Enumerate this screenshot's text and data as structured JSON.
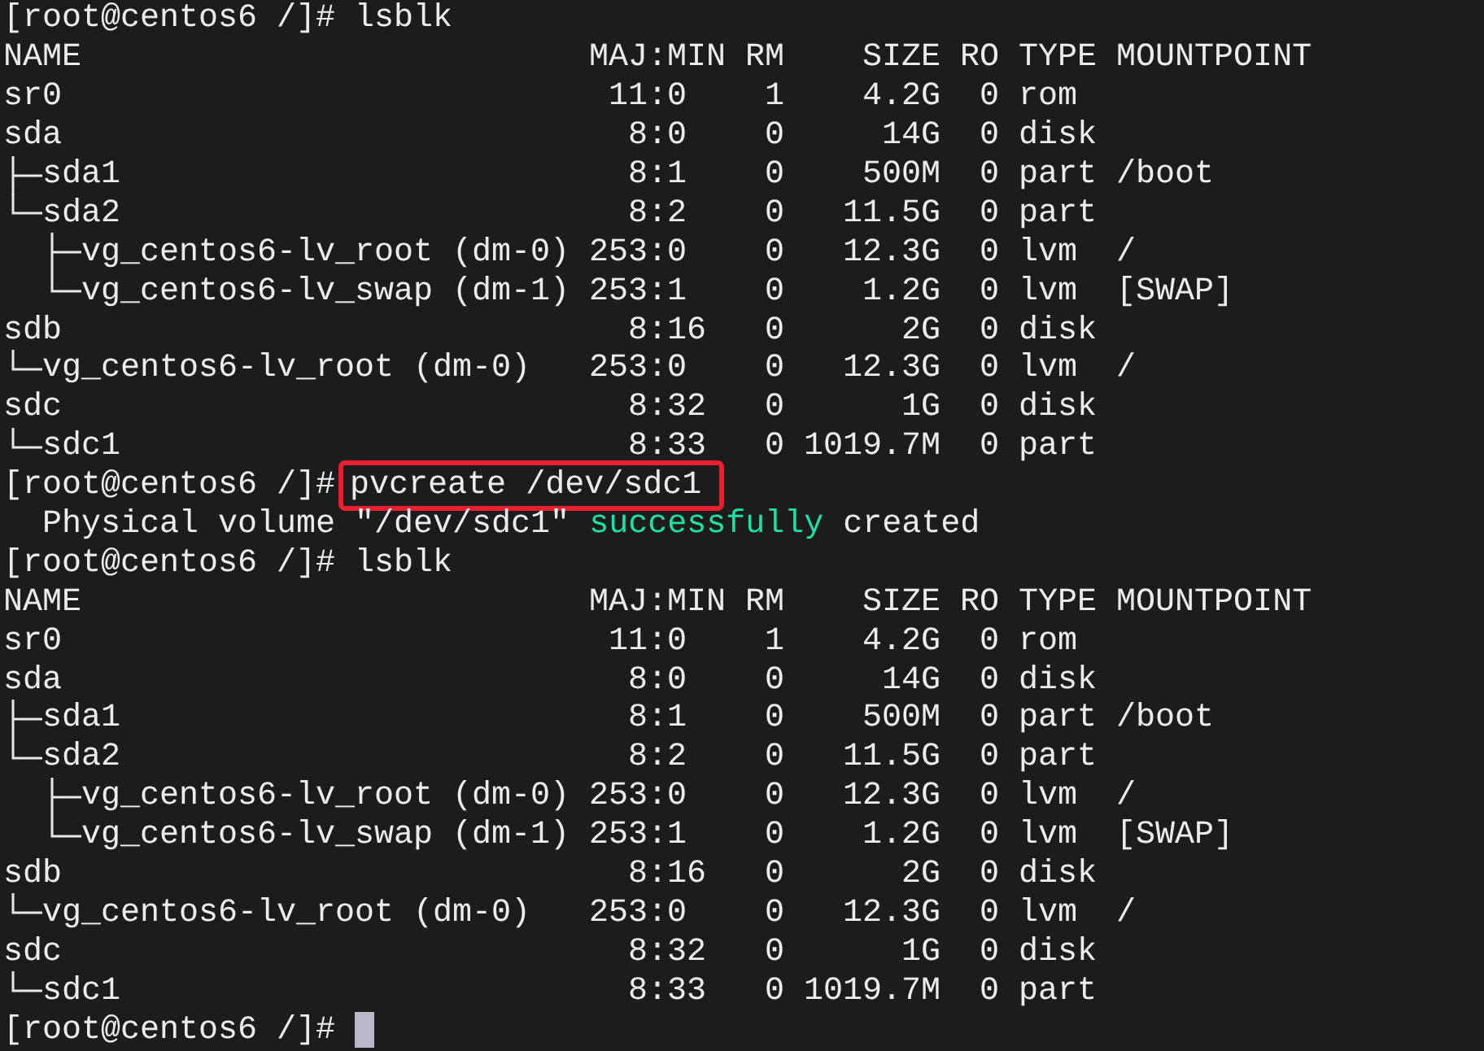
{
  "terminal": {
    "lines": [
      {
        "kind": "prompt",
        "prompt": "[root@centos6 /]#",
        "command": "lsblk",
        "highlighted": false
      },
      {
        "kind": "table",
        "columns": [
          "NAME",
          "MAJ:MIN",
          "RM",
          "SIZE",
          "RO",
          "TYPE",
          "MOUNTPOINT"
        ],
        "rows": [
          {
            "cells": [
              "sr0",
              "11:0",
              "1",
              "4.2G",
              "0",
              "rom"
            ]
          },
          {
            "cells": [
              "sda",
              "8:0",
              "0",
              "14G",
              "0",
              "disk"
            ],
            "children": [
              {
                "cells": [
                  "sda1",
                  "8:1",
                  "0",
                  "500M",
                  "0",
                  "part",
                  "/boot"
                ]
              },
              {
                "cells": [
                  "sda2",
                  "8:2",
                  "0",
                  "11.5G",
                  "0",
                  "part"
                ],
                "children": [
                  {
                    "cells": [
                      "vg_centos6-lv_root (dm-0)",
                      "253:0",
                      "0",
                      "12.3G",
                      "0",
                      "lvm",
                      "/"
                    ]
                  },
                  {
                    "cells": [
                      "vg_centos6-lv_swap (dm-1)",
                      "253:1",
                      "0",
                      "1.2G",
                      "0",
                      "lvm",
                      "[SWAP]"
                    ]
                  }
                ]
              }
            ]
          },
          {
            "cells": [
              "sdb",
              "8:16",
              "0",
              "2G",
              "0",
              "disk"
            ],
            "children": [
              {
                "cells": [
                  "vg_centos6-lv_root (dm-0)",
                  "253:0",
                  "0",
                  "12.3G",
                  "0",
                  "lvm",
                  "/"
                ]
              }
            ]
          },
          {
            "cells": [
              "sdc",
              "8:32",
              "0",
              "1G",
              "0",
              "disk"
            ],
            "children": [
              {
                "cells": [
                  "sdc1",
                  "8:33",
                  "0",
                  "1019.7M",
                  "0",
                  "part"
                ]
              }
            ]
          }
        ]
      },
      {
        "kind": "prompt",
        "prompt": "[root@centos6 /]#",
        "command": "pvcreate /dev/sdc1",
        "highlighted": true
      },
      {
        "kind": "message",
        "segments": [
          {
            "text": "Physical volume \"/dev/sdc1\""
          },
          {
            "text": "successfully",
            "color": "#1ee0a4"
          },
          {
            "text": "created"
          }
        ]
      },
      {
        "kind": "prompt",
        "prompt": "[root@centos6 /]#",
        "command": "lsblk",
        "highlighted": false
      },
      {
        "kind": "table",
        "columns": [
          "NAME",
          "MAJ:MIN",
          "RM",
          "SIZE",
          "RO",
          "TYPE",
          "MOUNTPOINT"
        ],
        "rows": [
          {
            "cells": [
              "sr0",
              "11:0",
              "1",
              "4.2G",
              "0",
              "rom"
            ]
          },
          {
            "cells": [
              "sda",
              "8:0",
              "0",
              "14G",
              "0",
              "disk"
            ],
            "children": [
              {
                "cells": [
                  "sda1",
                  "8:1",
                  "0",
                  "500M",
                  "0",
                  "part",
                  "/boot"
                ]
              },
              {
                "cells": [
                  "sda2",
                  "8:2",
                  "0",
                  "11.5G",
                  "0",
                  "part"
                ],
                "children": [
                  {
                    "cells": [
                      "vg_centos6-lv_root (dm-0)",
                      "253:0",
                      "0",
                      "12.3G",
                      "0",
                      "lvm",
                      "/"
                    ]
                  },
                  {
                    "cells": [
                      "vg_centos6-lv_swap (dm-1)",
                      "253:1",
                      "0",
                      "1.2G",
                      "0",
                      "lvm",
                      "[SWAP]"
                    ]
                  }
                ]
              }
            ]
          },
          {
            "cells": [
              "sdb",
              "8:16",
              "0",
              "2G",
              "0",
              "disk"
            ],
            "children": [
              {
                "cells": [
                  "vg_centos6-lv_root (dm-0)",
                  "253:0",
                  "0",
                  "12.3G",
                  "0",
                  "lvm",
                  "/"
                ]
              }
            ]
          },
          {
            "cells": [
              "sdc",
              "8:32",
              "0",
              "1G",
              "0",
              "disk"
            ],
            "children": [
              {
                "cells": [
                  "sdc1",
                  "8:33",
                  "0",
                  "1019.7M",
                  "0",
                  "part"
                ]
              }
            ]
          }
        ]
      },
      {
        "kind": "prompt",
        "prompt": "[root@centos6 /]#",
        "cursor": true
      }
    ]
  }
}
